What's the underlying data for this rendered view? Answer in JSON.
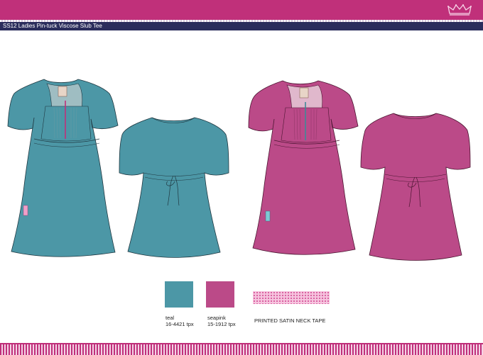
{
  "header": {
    "title": "SS12 Ladies Pin-tuck Viscose Slub Tee",
    "logo_icon": "crown-icon"
  },
  "colors": {
    "accent": "#c0307a",
    "navy": "#2b2d5c",
    "teal": "#4c97a6",
    "pink": "#bb4a88"
  },
  "swatches": [
    {
      "name": "teal",
      "code": "16-4421 tpx"
    },
    {
      "name": "seapink",
      "code": "15-1912 tpx"
    }
  ],
  "trim": {
    "label": "PRINTED SATIN NECK TAPE"
  },
  "garments": [
    {
      "colorway": "teal",
      "view": "front"
    },
    {
      "colorway": "teal",
      "view": "back"
    },
    {
      "colorway": "seapink",
      "view": "front"
    },
    {
      "colorway": "seapink",
      "view": "back"
    }
  ]
}
